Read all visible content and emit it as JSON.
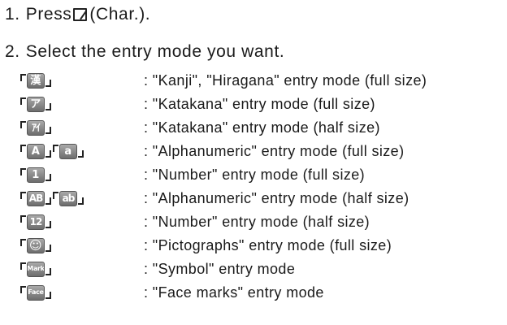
{
  "steps": [
    {
      "number": "1.",
      "text_before": "Press ",
      "text_after": "(Char.).",
      "key_icon": "char-key-icon"
    },
    {
      "number": "2.",
      "text": "Select the entry mode you want."
    }
  ],
  "modes": [
    {
      "keys": [
        "漢"
      ],
      "desc": ": \"Kanji\", \"Hiragana\" entry mode (full size)"
    },
    {
      "keys": [
        "ア"
      ],
      "desc": ": \"Katakana\" entry mode (full size)"
    },
    {
      "keys": [
        "ｱｲ"
      ],
      "desc": ": \"Katakana\" entry mode (half size)"
    },
    {
      "keys": [
        "A"
      ],
      "keys_b": [
        "a"
      ],
      "desc": ": \"Alphanumeric\" entry mode (full size)"
    },
    {
      "keys": [
        "1"
      ],
      "desc": ": \"Number\" entry mode (full size)"
    },
    {
      "keys": [
        "AB"
      ],
      "keys_b": [
        "ab"
      ],
      "desc": ": \"Alphanumeric\" entry mode (half size)"
    },
    {
      "keys": [
        "12"
      ],
      "desc": ": \"Number\" entry mode (half size)"
    },
    {
      "keys": [
        "☺"
      ],
      "desc": ": \"Pictographs\" entry mode (full size)"
    },
    {
      "keys": [
        "Mark"
      ],
      "desc": ": \"Symbol\" entry mode"
    },
    {
      "keys": [
        "Face"
      ],
      "desc": ": \"Face marks\" entry mode"
    }
  ],
  "colors": {
    "text": "#1a1a1a",
    "key_gradient_top": "#a9a9a9",
    "key_gradient_bottom": "#6d6d6d"
  }
}
